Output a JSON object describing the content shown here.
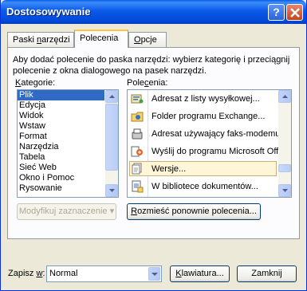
{
  "window": {
    "title": "Dostosowywanie",
    "help_label": "?"
  },
  "tabs": [
    {
      "label_before": "Paski ",
      "label_u": "n",
      "label_after": "arzędzi",
      "active": false
    },
    {
      "label_before": "Polecenia",
      "label_u": "",
      "label_after": "",
      "active": true
    },
    {
      "label_before": "",
      "label_u": "O",
      "label_after": "pcje",
      "active": false
    }
  ],
  "panel": {
    "description": "Aby dodać polecenie do paska narzędzi: wybierz kategorię i przeciągnij polecenie z okna dialogowego na pasek narzędzi.",
    "categories_label_u": "K",
    "categories_label_rest": "ategorie:",
    "commands_label_before": "Pole",
    "commands_label_u": "c",
    "commands_label_after": "enia:",
    "categories": [
      "Plik",
      "Edycja",
      "Widok",
      "Wstaw",
      "Format",
      "Narzędzia",
      "Tabela",
      "Sieć Web",
      "Okno i Pomoc",
      "Rysowanie"
    ],
    "selected_category": "Plik",
    "commands": [
      {
        "icon": "address-list-icon",
        "label": "Adresat z listy wysyłkowej..."
      },
      {
        "icon": "exchange-folder-icon",
        "label": "Folder programu Exchange..."
      },
      {
        "icon": "fax-recipient-icon",
        "label": "Adresat używający faks-modemu"
      },
      {
        "icon": "send-to-program-icon",
        "label": "Wyślij do programu Microsoft Office"
      },
      {
        "icon": "versions-icon",
        "label": "Wersje..."
      },
      {
        "icon": "document-library-icon",
        "label": "W bibliotece dokumentów..."
      }
    ],
    "modify_button": "Modyfikuj zaznaczenie",
    "rearrange_button_u": "R",
    "rearrange_button_rest": "ozmieść ponownie polecenia..."
  },
  "footer": {
    "save_in_label_before": "Zapisz ",
    "save_in_label_u": "w",
    "save_in_label_after": ":",
    "save_in_value": "Normal",
    "keyboard_button_u": "K",
    "keyboard_button_rest": "lawiatura...",
    "close_button": "Zamknij"
  },
  "colors": {
    "title_bar": "#0054e3",
    "selection": "#316ac5",
    "highlight_border": "#c9b07a"
  }
}
